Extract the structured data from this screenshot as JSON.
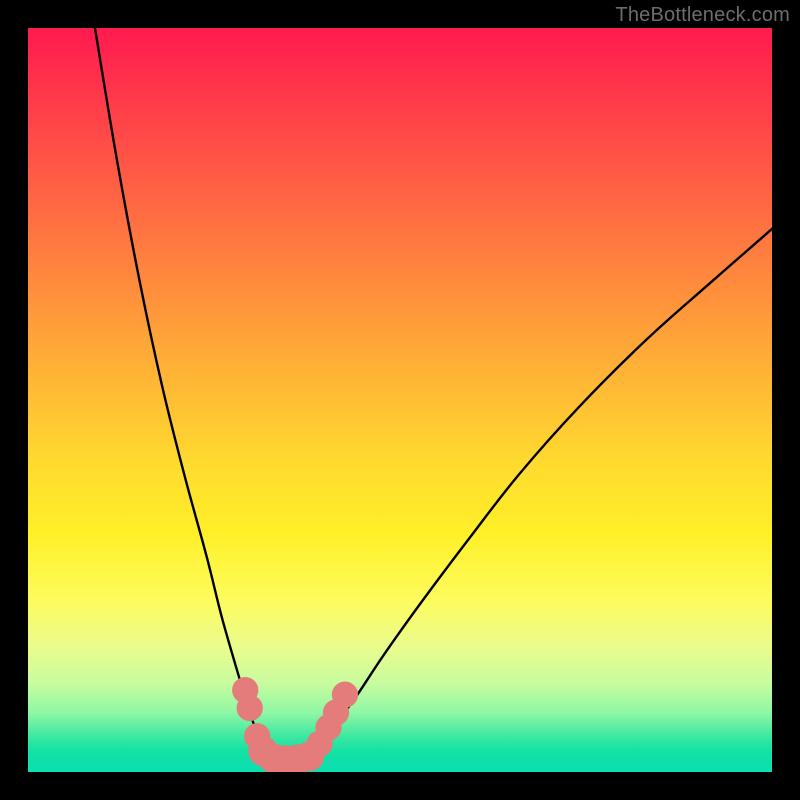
{
  "attribution": "TheBottleneck.com",
  "chart_data": {
    "type": "line",
    "title": "",
    "xlabel": "",
    "ylabel": "",
    "xlim": [
      0,
      100
    ],
    "ylim": [
      0,
      100
    ],
    "series": [
      {
        "name": "bottleneck-curve",
        "x": [
          9,
          12,
          15,
          18,
          21,
          24,
          26,
          28,
          29.5,
          30.5,
          31.5,
          33,
          35,
          37.5,
          39,
          41,
          44,
          48,
          53,
          59,
          66,
          74,
          83,
          92,
          100
        ],
        "y": [
          100,
          82,
          66,
          52,
          40,
          29,
          21,
          14,
          9,
          6,
          3.5,
          2,
          1.5,
          2,
          3.5,
          6,
          10,
          16,
          23,
          31,
          40,
          49,
          58,
          66,
          73
        ]
      }
    ],
    "markers": {
      "name": "highlighted-points",
      "color": "#e47c7c",
      "points": [
        {
          "x": 29.2,
          "y": 11.0,
          "r": 1.6
        },
        {
          "x": 29.8,
          "y": 8.6,
          "r": 1.6
        },
        {
          "x": 30.8,
          "y": 4.8,
          "r": 1.6
        },
        {
          "x": 31.6,
          "y": 2.8,
          "r": 2.0
        },
        {
          "x": 33.0,
          "y": 1.8,
          "r": 2.0
        },
        {
          "x": 34.6,
          "y": 1.6,
          "r": 2.0
        },
        {
          "x": 36.2,
          "y": 1.7,
          "r": 2.0
        },
        {
          "x": 37.8,
          "y": 2.1,
          "r": 2.0
        },
        {
          "x": 39.2,
          "y": 3.8,
          "r": 1.6
        },
        {
          "x": 40.4,
          "y": 6.0,
          "r": 1.6
        },
        {
          "x": 41.4,
          "y": 8.0,
          "r": 1.6
        },
        {
          "x": 42.6,
          "y": 10.4,
          "r": 1.6
        }
      ]
    }
  }
}
